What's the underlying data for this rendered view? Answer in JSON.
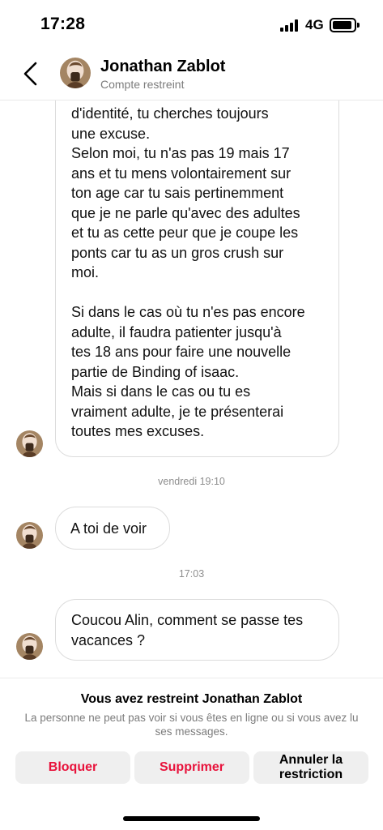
{
  "status_bar": {
    "time": "17:28",
    "network": "4G",
    "battery_level": 0.9
  },
  "header": {
    "back_icon": "chevron-left-icon",
    "name": "Jonathan Zablot",
    "subtitle": "Compte restreint"
  },
  "messages": {
    "long_message": {
      "lines_a": [
        "d'identité, tu cherches toujours",
        "une excuse.",
        "Selon moi, tu n'as pas 19 mais  17",
        "ans et tu mens volontairement sur",
        "ton age car tu sais pertinemment",
        "que je ne parle qu'avec des adultes",
        "et tu as cette peur que je coupe les",
        "ponts car tu as un gros crush sur",
        "moi."
      ],
      "lines_b": [
        "Si dans le cas où tu n'es pas encore",
        "adulte, il faudra patienter jusqu'à",
        "tes 18 ans pour faire une nouvelle",
        "partie de Binding of isaac.",
        "Mais si dans le cas ou tu es",
        "vraiment adulte, je te présenterai",
        "toutes mes excuses."
      ]
    },
    "timestamp_1": "vendredi 19:10",
    "short_message": "A toi de voir",
    "timestamp_2": "17:03",
    "mid_message_lines": [
      "Coucou Alin, comment se passe tes",
      "vacances ?"
    ]
  },
  "restriction": {
    "title": "Vous avez restreint Jonathan Zablot",
    "description": "La personne ne peut pas voir si vous êtes en ligne ou si vous avez lu ses messages.",
    "block_label": "Bloquer",
    "delete_label": "Supprimer",
    "unrestrict_label_line1": "Annuler la",
    "unrestrict_label_line2": "restriction"
  },
  "colors": {
    "destructive": "#e8123b",
    "muted_text": "#7c7c7c",
    "button_bg": "#efefef",
    "bubble_border": "#dcdcdc"
  }
}
